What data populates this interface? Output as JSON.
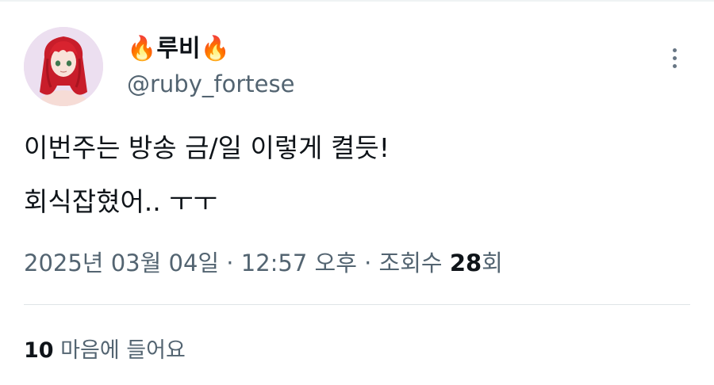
{
  "author": {
    "display_name": "🔥루비🔥",
    "handle": "@ruby_fortese"
  },
  "tweet": {
    "lines": [
      "이번주는 방송 금/일 이렇게 켤듯!",
      "회식잡혔어.. ㅜㅜ"
    ]
  },
  "meta": {
    "date_time": "2025년 03월 04일 · 12:57 오후 · 조회수 ",
    "views": "28",
    "views_suffix": "회"
  },
  "likes": {
    "count": "10",
    "label": "마음에 들어요"
  },
  "icons": {
    "more": "more-vertical-icon"
  },
  "colors": {
    "text_primary": "#0f1419",
    "text_secondary": "#536471",
    "divider": "#dfe4e7"
  }
}
